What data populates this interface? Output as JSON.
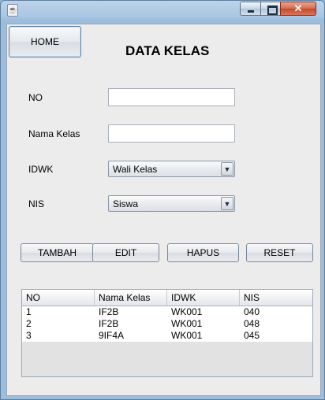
{
  "window": {
    "app_icon": "java-icon",
    "minimize_icon": "minimize-icon",
    "maximize_icon": "maximize-icon",
    "close_icon": "close-icon",
    "close_glyph": "✕"
  },
  "header": {
    "home_label": "HOME",
    "title": "DATA KELAS"
  },
  "form": {
    "no_label": "NO",
    "no_value": "",
    "nama_kelas_label": "Nama Kelas",
    "nama_kelas_value": "",
    "idwk_label": "IDWK",
    "idwk_selected": "Wali Kelas",
    "nis_label": "NIS",
    "nis_selected": "Siswa",
    "dropdown_arrow": "▼"
  },
  "actions": {
    "tambah": "TAMBAH",
    "edit": "EDIT",
    "hapus": "HAPUS",
    "reset": "RESET"
  },
  "table": {
    "columns": [
      "NO",
      "Nama Kelas",
      "IDWK",
      "NIS"
    ],
    "rows": [
      [
        "1",
        "IF2B",
        "WK001",
        "040"
      ],
      [
        "2",
        "IF2B",
        "WK001",
        "048"
      ],
      [
        "3",
        "9IF4A",
        "WK001",
        "045"
      ]
    ]
  }
}
